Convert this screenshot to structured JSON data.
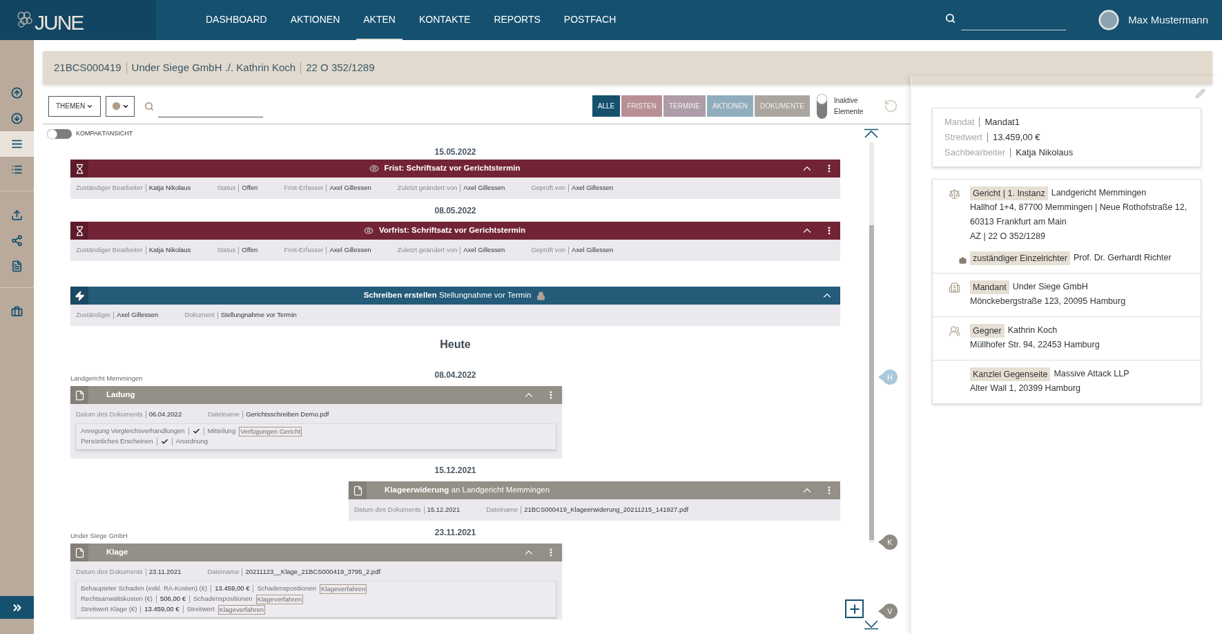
{
  "logo": {
    "text": "JUNE"
  },
  "nav": [
    {
      "label": "DASHBOARD",
      "selected": false
    },
    {
      "label": "AKTIONEN",
      "selected": false
    },
    {
      "label": "AKTEN",
      "selected": true
    },
    {
      "label": "KONTAKTE",
      "selected": false
    },
    {
      "label": "REPORTS",
      "selected": false
    },
    {
      "label": "POSTFACH",
      "selected": false
    }
  ],
  "user": {
    "name": "Max Mustermann"
  },
  "sidebar": {
    "groups": [
      [
        {
          "kind": "scroll-up",
          "selected": false
        },
        {
          "kind": "scroll-down",
          "selected": false
        },
        {
          "kind": "timeline",
          "selected": true
        },
        {
          "kind": "list",
          "selected": false
        }
      ],
      [
        {
          "kind": "upload",
          "selected": false
        },
        {
          "kind": "share",
          "selected": false
        },
        {
          "kind": "document",
          "selected": false
        }
      ],
      [
        {
          "kind": "briefcase",
          "selected": false
        }
      ]
    ]
  },
  "case_header": {
    "segments": [
      "21BCS000419",
      "Under Siege GmbH ./. Kathrin Koch",
      "22 O 352/1289"
    ]
  },
  "toolbar": {
    "themes": "THEMEN",
    "filters": [
      {
        "label": "ALLE",
        "selected": true,
        "color": "#15506f"
      },
      {
        "label": "FRISTEN",
        "selected": false,
        "color": "#b98f96"
      },
      {
        "label": "TERMINE",
        "selected": false,
        "color": "#ae9ca8"
      },
      {
        "label": "AKTIONEN",
        "selected": false,
        "color": "#8fadbd"
      },
      {
        "label": "DOKUMENTE",
        "selected": false,
        "color": "#aaa59f"
      }
    ],
    "inactive_toggle": {
      "label": "Inaktive Elemente",
      "on": false
    }
  },
  "compact_toggle": {
    "label": "KOMPAKTANSICHT",
    "on": false
  },
  "timeline": [
    {
      "kind": "date",
      "text": "15.05.2022"
    },
    {
      "kind": "frist",
      "title": "Frist: Schriftsatz vor Gerichtstermin",
      "watched": true,
      "locked": false,
      "expanded": true,
      "fields": [
        {
          "label": "Zuständiger Bearbeiter",
          "value": "Katja Nikolaus"
        },
        {
          "label": "Status",
          "value": "Offen"
        },
        {
          "label": "Frist-Erfasser",
          "value": "Axel Gillessen"
        },
        {
          "label": "Zuletzt geändert von",
          "value": "Axel Gillessen"
        },
        {
          "label": "Geprüft von",
          "value": "Axel Gillessen"
        }
      ]
    },
    {
      "kind": "date",
      "text": "08.05.2022"
    },
    {
      "kind": "frist",
      "title": "Vorfrist: Schriftsatz vor Gerichtstermin",
      "watched": true,
      "locked": false,
      "expanded": true,
      "fields": [
        {
          "label": "Zuständiger Bearbeiter",
          "value": "Katja Nikolaus"
        },
        {
          "label": "Status",
          "value": "Offen"
        },
        {
          "label": "Frist-Erfasser",
          "value": "Axel Gillessen"
        },
        {
          "label": "Zuletzt geändert von",
          "value": "Axel Gillessen"
        },
        {
          "label": "Geprüft von",
          "value": "Axel Gillessen"
        }
      ]
    },
    {
      "kind": "aktion",
      "title": "Schreiben erstellen",
      "subtitle": "Stellungnahme vor Termin",
      "watched": false,
      "locked": true,
      "expanded": true,
      "fields": [
        {
          "label": "Zuständiger",
          "value": "Axel Gillessen"
        },
        {
          "label": "Dokument",
          "value": "Stellungnahme vor Termin"
        }
      ]
    },
    {
      "kind": "today",
      "text": "Heute"
    },
    {
      "kind": "date",
      "text": "08.04.2022",
      "source": "Landgericht Memmingen"
    },
    {
      "kind": "dokument",
      "title": "Ladung",
      "watched": false,
      "locked": false,
      "expanded": true,
      "fields": [
        {
          "label": "Datum des Dokuments",
          "value": "06.04.2022"
        },
        {
          "label": "Dateiname",
          "value": "Gerichtsschreiben Demo.pdf"
        }
      ],
      "extras": [
        {
          "kind": "check",
          "label": "Anregung Vergleichsverhandlungen",
          "checked": true,
          "category": "Mitteilung",
          "tag": "Verfügungen Gericht"
        },
        {
          "kind": "check",
          "label": "Persönliches Erscheinen",
          "checked": true,
          "category": "Anordnung"
        }
      ]
    },
    {
      "kind": "date",
      "text": "15.12.2021"
    },
    {
      "kind": "gegenseite",
      "title": "Klageerwiderung",
      "subtitle": "an Landgericht Memmingen",
      "watched": false,
      "locked": false,
      "expanded": true,
      "fields": [
        {
          "label": "Datum des Dokuments",
          "value": "15.12.2021"
        },
        {
          "label": "Dateiname",
          "value": "21BCS000419_Klageerwiderung_20211215_141927.pdf"
        }
      ]
    },
    {
      "kind": "date",
      "text": "23.11.2021",
      "source": "Under Siege GmbH"
    },
    {
      "kind": "dokument",
      "title": "Klage",
      "watched": false,
      "locked": false,
      "expanded": true,
      "fields": [
        {
          "label": "Datum des Dokuments",
          "value": "23.11.2021"
        },
        {
          "label": "Dateiname",
          "value": "20211123__Klage_21BCS000419_3795_2.pdf"
        }
      ],
      "extras": [
        {
          "kind": "amount",
          "label": "Behaupteter Schaden (exkl. RA-Kosten) (€)",
          "value": "13.459,00 €",
          "category": "Schadenspositionen",
          "tag": "Klageverfahren"
        },
        {
          "kind": "amount",
          "label": "Rechtsanwaltskosten (€)",
          "value": "506,00 €",
          "category": "Schadenspositionen",
          "tag": "Klageverfahren"
        },
        {
          "kind": "amount",
          "label": "Streitwert Klage (€)",
          "value": "13.459,00 €",
          "category": "Streitwert",
          "tag": "Klageverfahren"
        }
      ]
    }
  ],
  "timeline_markers": [
    {
      "label": "H",
      "color": "#a9c8dc"
    },
    {
      "label": "K",
      "color": "#8f8a83"
    },
    {
      "label": "V",
      "color": "#8f8a83"
    }
  ],
  "summary": [
    {
      "label": "Mandat",
      "value": "Mandat1"
    },
    {
      "label": "Streitwert",
      "value": "13.459,00 €"
    },
    {
      "label": "Sachbearbeiter",
      "value": "Katja Nikolaus"
    }
  ],
  "parties": [
    {
      "kind": "court",
      "tag": "Gericht | 1. Instanz",
      "name": "Landgericht Memmingen",
      "lines": [
        "Hallhof 1+4, 87700 Memmingen | Neue Rothofstraße 12, 60313 Frankfurt am Main",
        "AZ | 22 O 352/1289"
      ],
      "judge": {
        "tag": "zuständiger Einzelrichter",
        "name": "Prof. Dr. Gerhardt Richter"
      }
    },
    {
      "kind": "client",
      "tag": "Mandant",
      "name": "Under Siege GmbH",
      "lines": [
        "Mönckebergstraße 123, 20095 Hamburg"
      ]
    },
    {
      "kind": "opponent",
      "tag": "Gegner",
      "name": "Kathrin Koch",
      "lines": [
        "Müllhofer Str. 94, 22453 Hamburg"
      ]
    },
    {
      "kind": "counsel",
      "tag": "Kanzlei Gegenseite",
      "name": "Massive Attack LLP",
      "lines": [
        "Alter Wall 1, 20399 Hamburg"
      ]
    }
  ]
}
